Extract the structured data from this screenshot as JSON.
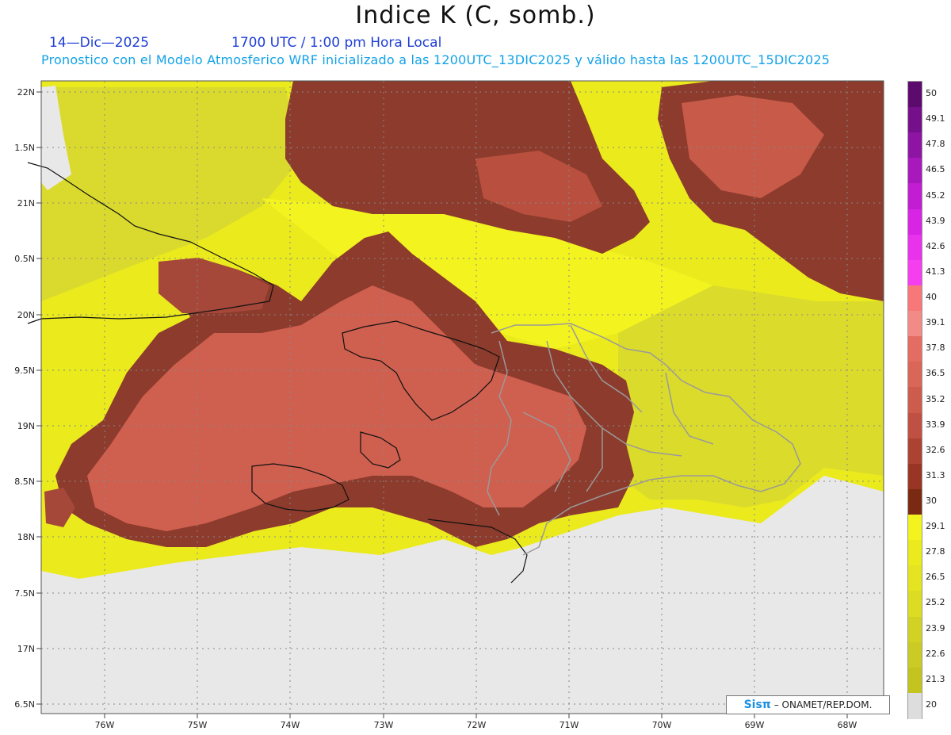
{
  "title": "Indice K (C, somb.)",
  "date_label": "14—Dic—2025",
  "time_label": "1700 UTC / 1:00 pm Hora Local",
  "subtitle": "Pronostico con el Modelo Atmosferico WRF inicializado a las 1200UTC_13DIC2025 y válido hasta las  1200UTC_15DIC2025",
  "credit": {
    "logo": "Sisπ",
    "text": "– ONAMET/REP.DOM."
  },
  "lat_labels": [
    "22N",
    "1.5N",
    "21N",
    "0.5N",
    "20N",
    "9.5N",
    "19N",
    "8.5N",
    "18N",
    "7.5N",
    "17N",
    "6.5N"
  ],
  "lon_labels": [
    "76W",
    "75W",
    "74W",
    "73W",
    "72W",
    "71W",
    "70W",
    "69W",
    "68W"
  ],
  "legend": {
    "labels": [
      "50",
      "49.1",
      "47.8",
      "46.5",
      "45.2",
      "43.9",
      "42.6",
      "41.3",
      "40",
      "39.1",
      "37.8",
      "36.5",
      "35.2",
      "33.9",
      "32.6",
      "31.3",
      "30",
      "29.1",
      "27.8",
      "26.5",
      "25.2",
      "23.9",
      "22.6",
      "21.3",
      "20"
    ],
    "colors": [
      "#5d0a6e",
      "#76108a",
      "#8e14a3",
      "#a818bc",
      "#c21dd3",
      "#d824e4",
      "#e832ec",
      "#f43ef0",
      "#f8787a",
      "#f28a86",
      "#e56c62",
      "#d96656",
      "#cd5c4d",
      "#bf5043",
      "#ac4232",
      "#983524",
      "#7a2a12",
      "#f3f31e",
      "#eaea1c",
      "#e4e420",
      "#dcdc22",
      "#d2d224",
      "#cbcb25",
      "#c4c421",
      "#dddddd"
    ]
  },
  "colors": {
    "land_dark": "#8c3b2c",
    "land_light": "#cf5f4f",
    "sea_yellow": "#eaea1d",
    "bright_yellow": "#f3f31f",
    "olive": "#d7d731",
    "no_data": "#e8e8e8"
  }
}
